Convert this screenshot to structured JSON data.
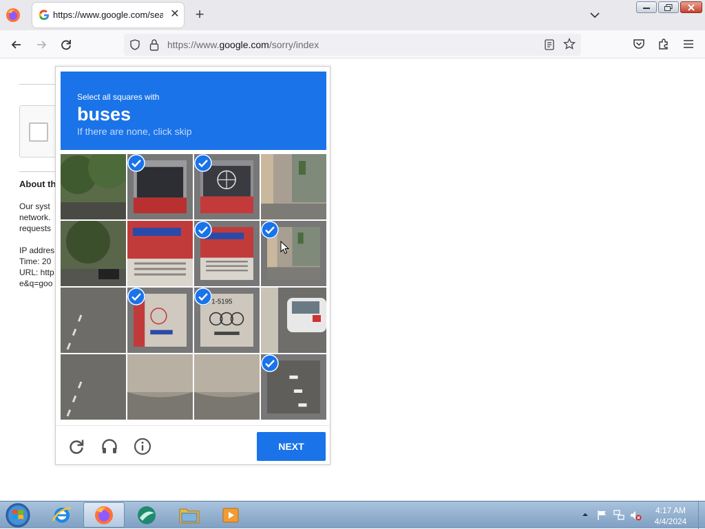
{
  "browser": {
    "tab_title": "https://www.google.com/search",
    "url_prefix": "https://www.",
    "url_domain": "google.com",
    "url_path": "/sorry/index"
  },
  "background_page": {
    "about_heading": "About th",
    "para_line1": "Our syst",
    "para_line2": "network.",
    "para_line3": "requests",
    "ip_line": "IP addres",
    "time_line": "Time: 20",
    "url_line": "URL: http",
    "query_line": "e&q=goo"
  },
  "challenge": {
    "prompt": "Select all squares with",
    "keyword": "buses",
    "hint": "If there are none, click skip",
    "next_label": "NEXT",
    "tiles": [
      {
        "selected": false,
        "scene": "trees"
      },
      {
        "selected": true,
        "scene": "bus-window"
      },
      {
        "selected": true,
        "scene": "bus-window-logo"
      },
      {
        "selected": false,
        "scene": "street-building"
      },
      {
        "selected": false,
        "scene": "trees-road"
      },
      {
        "selected": false,
        "scene": "bus-rear-red"
      },
      {
        "selected": true,
        "scene": "bus-rear-red"
      },
      {
        "selected": true,
        "scene": "street-building"
      },
      {
        "selected": false,
        "scene": "road"
      },
      {
        "selected": true,
        "scene": "bus-light"
      },
      {
        "selected": true,
        "scene": "bus-plate"
      },
      {
        "selected": false,
        "scene": "car-road"
      },
      {
        "selected": false,
        "scene": "road"
      },
      {
        "selected": false,
        "scene": "bus-bumper"
      },
      {
        "selected": false,
        "scene": "bus-bumper"
      },
      {
        "selected": true,
        "scene": "road-lines"
      }
    ]
  },
  "taskbar": {
    "time": "4:17 AM",
    "date": "4/4/2024"
  },
  "colors": {
    "accent": "#1a73e8",
    "header_hint": "#c5dafc"
  }
}
